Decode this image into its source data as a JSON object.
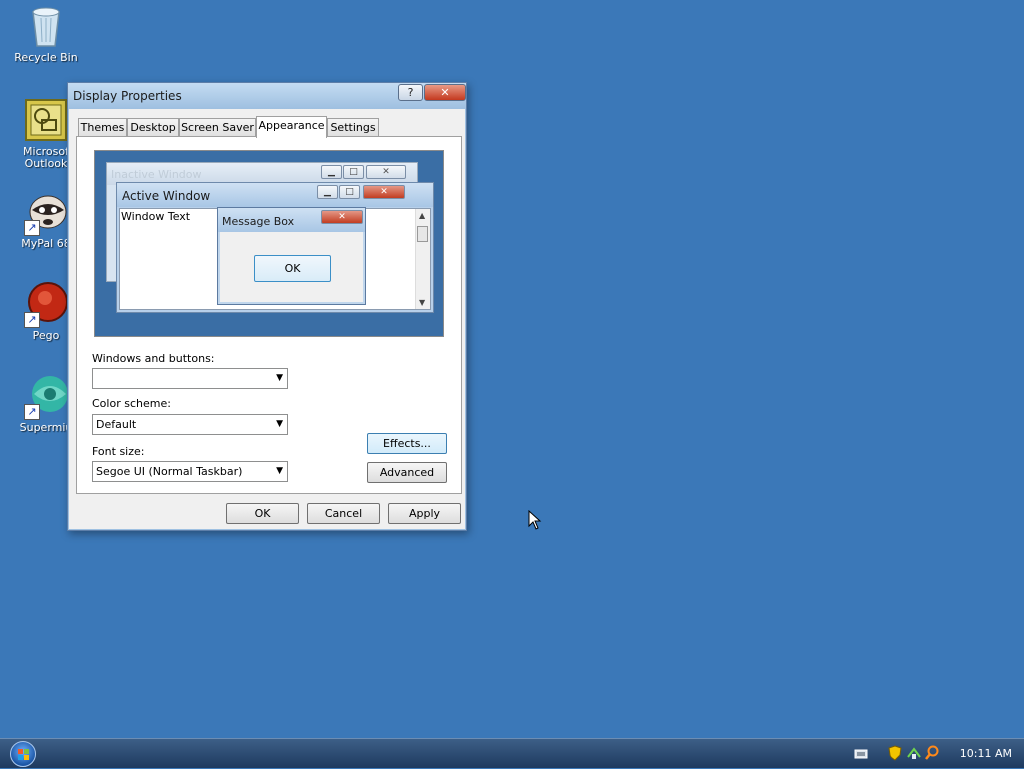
{
  "desktop": {
    "icons": [
      {
        "label": "Recycle Bin",
        "icon": "recycle-bin-icon"
      },
      {
        "label": "Microsof\nOutlook",
        "icon": "outlook-icon"
      },
      {
        "label": "MyPal 68",
        "icon": "mypal-raccoon-icon"
      },
      {
        "label": "Pego",
        "icon": "pego-icon"
      },
      {
        "label": "Supermiu",
        "icon": "supermium-icon"
      }
    ]
  },
  "dialog": {
    "title": "Display Properties",
    "help_label": "?",
    "close_label": "✕",
    "tabs": [
      {
        "label": "Themes"
      },
      {
        "label": "Desktop"
      },
      {
        "label": "Screen Saver"
      },
      {
        "label": "Appearance"
      },
      {
        "label": "Settings"
      }
    ],
    "active_tab": "Appearance",
    "preview": {
      "inactive_title": "Inactive Window",
      "active_title": "Active Window",
      "window_text": "Window Text",
      "message_title": "Message Box",
      "message_ok": "OK"
    },
    "windows_buttons_label": "Windows and buttons:",
    "windows_buttons_value": "",
    "color_scheme_label": "Color scheme:",
    "color_scheme_value": "Default",
    "font_size_label": "Font size:",
    "font_size_value": "Segoe UI (Normal Taskbar)",
    "effects_label": "Effects...",
    "advanced_label": "Advanced",
    "ok_label": "OK",
    "cancel_label": "Cancel",
    "apply_label": "Apply"
  },
  "taskbar": {
    "clock": "10:11 AM",
    "tray_icons": [
      "keyboard-icon",
      "security-shield-icon",
      "network-icon",
      "search-icon"
    ]
  },
  "colors": {
    "desktop": "#3b78b8",
    "taskbar": "#1e3a5f",
    "accent": "#3c7fb1"
  }
}
